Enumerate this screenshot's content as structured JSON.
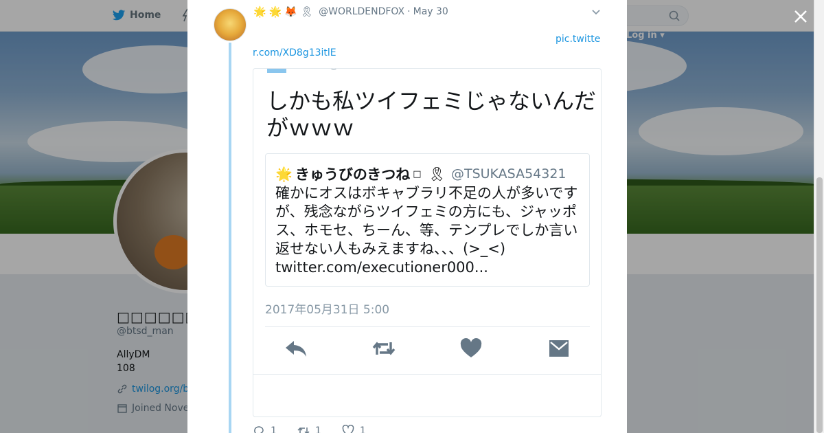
{
  "topbar": {
    "home_label": "Home",
    "login_label": "Log in"
  },
  "profile": {
    "name": "□□□□□□□□□",
    "handle": "@btsd_man",
    "bio_line1": "AllyDM",
    "bio_line2": "108",
    "link": "twilog.org/b",
    "joined": "Joined Nove"
  },
  "tweet": {
    "emojis": [
      "🌟",
      "🌟",
      "🦊",
      "🎗"
    ],
    "handle": "@WORLDENDFOX",
    "separator": "·",
    "date": "May 30",
    "link_part1": "pic.twitte",
    "link_part2": "r.com/XD8g13itlE",
    "media": {
      "main_text": "しかも私ツイフェミじゃないんだがｗｗｗ",
      "quote": {
        "name_emoji": "🌟",
        "name": "きゅうびのきつね",
        "name_suffix": "□",
        "ribbon_emoji": "🎗",
        "handle": "@TSUKASA54321",
        "body": "確かにオスはボキャブラリ不足の人が多いですが、残念ながらツイフェミの方にも、ジャッポス、ホモセ、ちーん、等、テンプレでしか言い返せない人もみえますね、、、(>_<) twitter.com/executioner000..."
      },
      "timestamp": "2017年05月31日 5:00"
    },
    "footer": {
      "reply_count": "1",
      "retweet_count": "1",
      "like_count": "1"
    }
  },
  "colors": {
    "accent": "#1b95e0",
    "thread": "#a8d6f3",
    "text": "#14171a",
    "muted": "#657786"
  }
}
